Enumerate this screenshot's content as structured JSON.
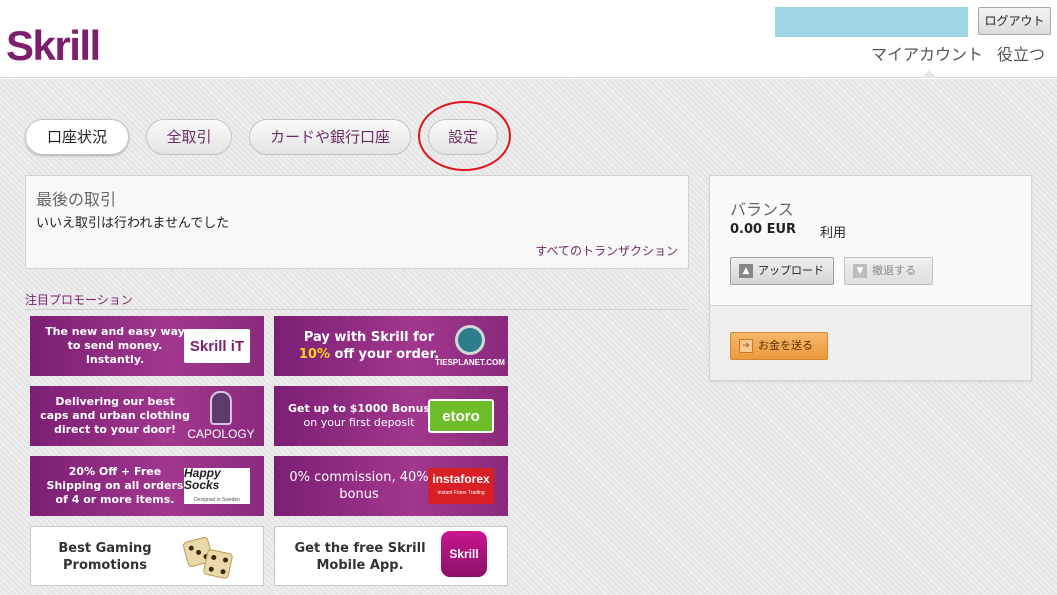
{
  "header": {
    "logo": "Skrill",
    "logout_label": "ログアウト",
    "nav": {
      "my_account": "マイアカウント",
      "help": "役立つ"
    }
  },
  "tabs": [
    {
      "label": "口座状況",
      "active": true
    },
    {
      "label": "全取引",
      "active": false
    },
    {
      "label": "カードや銀行口座",
      "active": false
    },
    {
      "label": "設定",
      "active": false
    }
  ],
  "last_transactions": {
    "title": "最後の取引",
    "empty_message": "いいえ取引は行われませんでした",
    "all_link": "すべてのトランザクション"
  },
  "promotions": {
    "heading": "注目プロモーション",
    "items": [
      {
        "text": "The new and easy way to send money. Instantly.",
        "logo": "Skrill iT"
      },
      {
        "text_a": "Pay with Skrill for",
        "text_b": "10%",
        "text_c": "off your order.",
        "logo": "TIESPLANET.COM"
      },
      {
        "text": "Delivering our best caps and urban clothing direct to your door!",
        "logo": "CAPOLOGY"
      },
      {
        "text": "Get up to $1000 Bonus",
        "subtext": "on your first deposit",
        "logo": "etoro"
      },
      {
        "text": "20% Off + Free Shipping on all orders of 4 or more items.",
        "logo": "Happy Socks",
        "logo_sub": "Designed in Sweden"
      },
      {
        "text": "0% commission, 40% bonus",
        "logo": "instaforex",
        "logo_sub": "Instant Forex Trading"
      },
      {
        "text": "Best Gaming Promotions"
      },
      {
        "text": "Get the free Skrill Mobile App.",
        "logo": "Skrill"
      }
    ]
  },
  "balance": {
    "title": "バランス",
    "amount": "0.00 EUR",
    "status": "利用",
    "upload_label": "アップロード",
    "withdraw_label": "撤退する",
    "send_label": "お金を送る"
  },
  "colors": {
    "brand": "#7d1f6e",
    "promo_purple": "#a2378e",
    "send_orange": "#ec9a3c",
    "highlight_red": "#e01616"
  }
}
